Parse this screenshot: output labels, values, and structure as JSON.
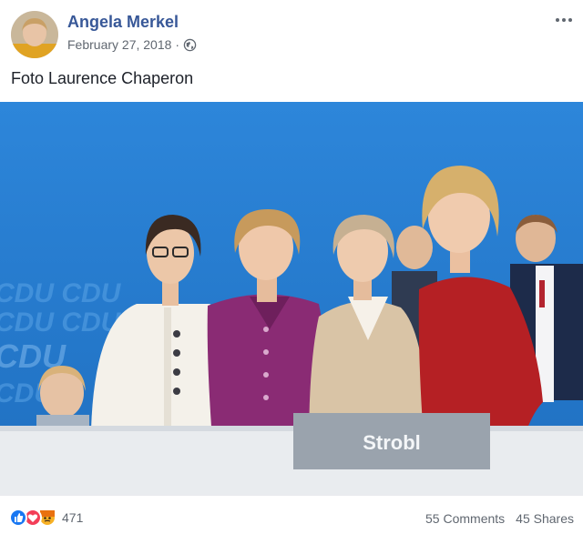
{
  "post": {
    "author": "Angela Merkel",
    "date": "February 27, 2018",
    "separator": "·",
    "privacy_icon": "globe-icon",
    "more_icon": "ellipsis-icon",
    "caption": "Foto Laurence Chaperon"
  },
  "photo": {
    "backdrop_text": [
      "CDU CDU",
      "CDU CDU",
      "CDU",
      "CDU"
    ],
    "name_plate": "Strobl",
    "colors": {
      "backdrop": "#2a83d6",
      "stage": "#e9ecef",
      "plate": "#9aa3ad"
    }
  },
  "footer": {
    "reaction_icons": [
      "like-icon",
      "love-icon",
      "angry-icon"
    ],
    "reaction_count": "471",
    "comments": "55 Comments",
    "shares": "45 Shares"
  },
  "colors": {
    "brand_link": "#385898",
    "meta_gray": "#606770",
    "like_blue": "#1877f2",
    "love_red": "#f33e58",
    "angry_orange": "#f7b125"
  }
}
